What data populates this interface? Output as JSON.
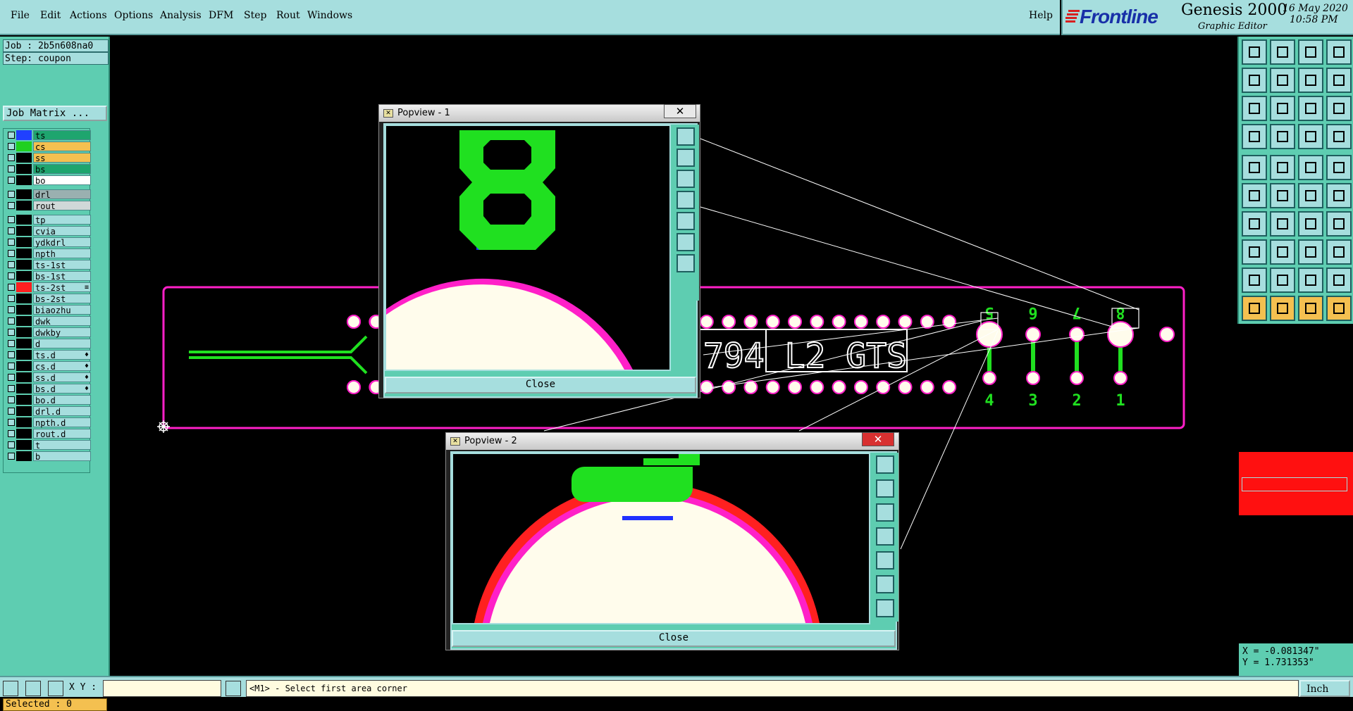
{
  "menu": [
    "File",
    "Edit",
    "Actions",
    "Options",
    "Analysis",
    "DFM",
    "Step",
    "Rout",
    "Windows"
  ],
  "help": "Help",
  "brand": {
    "logo": "Frontline",
    "product": "Genesis 2000",
    "subtitle": "Graphic Editor",
    "date": "16 May 2020",
    "time": "10:58 PM"
  },
  "job": "Job : 2b5n608na0",
  "step": "Step: coupon",
  "job_matrix": "Job Matrix ...",
  "layers": [
    {
      "name": "ts",
      "color": "#2040ff",
      "bg": "#1ea56e"
    },
    {
      "name": "cs",
      "color": "#20d020",
      "bg": "#f4c050"
    },
    {
      "name": "ss",
      "color": "",
      "bg": "#f4c050"
    },
    {
      "name": "bs",
      "color": "",
      "bg": "#1ea56e"
    },
    {
      "name": "bo",
      "color": "",
      "bg": "#ffffff"
    },
    {
      "name": "drl",
      "color": "",
      "bg": "#9ab0b0"
    },
    {
      "name": "rout",
      "color": "",
      "bg": "#d0d8d8"
    },
    {
      "name": "tp",
      "color": "",
      "bg": ""
    },
    {
      "name": "cvia",
      "color": "",
      "bg": ""
    },
    {
      "name": "ydkdrl",
      "color": "",
      "bg": ""
    },
    {
      "name": "npth",
      "color": "",
      "bg": ""
    },
    {
      "name": "ts-1st",
      "color": "",
      "bg": ""
    },
    {
      "name": "bs-1st",
      "color": "",
      "bg": ""
    },
    {
      "name": "ts-2st",
      "color": "#ff2020",
      "bg": "",
      "mark": "≡"
    },
    {
      "name": "bs-2st",
      "color": "",
      "bg": ""
    },
    {
      "name": "biaozhu",
      "color": "",
      "bg": ""
    },
    {
      "name": "dwk",
      "color": "",
      "bg": ""
    },
    {
      "name": "dwkby",
      "color": "",
      "bg": ""
    },
    {
      "name": "d",
      "color": "",
      "bg": ""
    },
    {
      "name": "ts.d",
      "color": "",
      "bg": "",
      "mark": "♦"
    },
    {
      "name": "cs.d",
      "color": "",
      "bg": "",
      "mark": "♦"
    },
    {
      "name": "ss.d",
      "color": "",
      "bg": "",
      "mark": "♦"
    },
    {
      "name": "bs.d",
      "color": "",
      "bg": "",
      "mark": "♦"
    },
    {
      "name": "bo.d",
      "color": "",
      "bg": ""
    },
    {
      "name": "drl.d",
      "color": "",
      "bg": ""
    },
    {
      "name": "npth.d",
      "color": "",
      "bg": ""
    },
    {
      "name": "rout.d",
      "color": "",
      "bg": ""
    },
    {
      "name": "t",
      "color": "",
      "bg": ""
    },
    {
      "name": "b",
      "color": "",
      "bg": ""
    }
  ],
  "selected": "Selected : 0",
  "board": {
    "text": "794 L2 GTS",
    "top_numbers": [
      "5",
      "6",
      "7",
      "8"
    ],
    "bottom_numbers": [
      "4",
      "3",
      "2",
      "1"
    ]
  },
  "popup1": {
    "title": "Popview - 1",
    "close": "Close",
    "close_x": "✕",
    "digit": "8"
  },
  "popup2": {
    "title": "Popview - 2",
    "close": "Close",
    "close_x": "✕"
  },
  "coords": {
    "x": "X = -0.081347\"",
    "y": "Y = 1.731353\""
  },
  "status": {
    "xy_label": "X Y :",
    "prompt": "<M1> - Select first area corner",
    "units": "Inch"
  },
  "colors": {
    "panel": "#5ecdb1",
    "light": "#a6dede",
    "highlight": "#f4c050",
    "magenta": "#ff20c8",
    "green": "#20e020",
    "pad": "#fffcec"
  }
}
